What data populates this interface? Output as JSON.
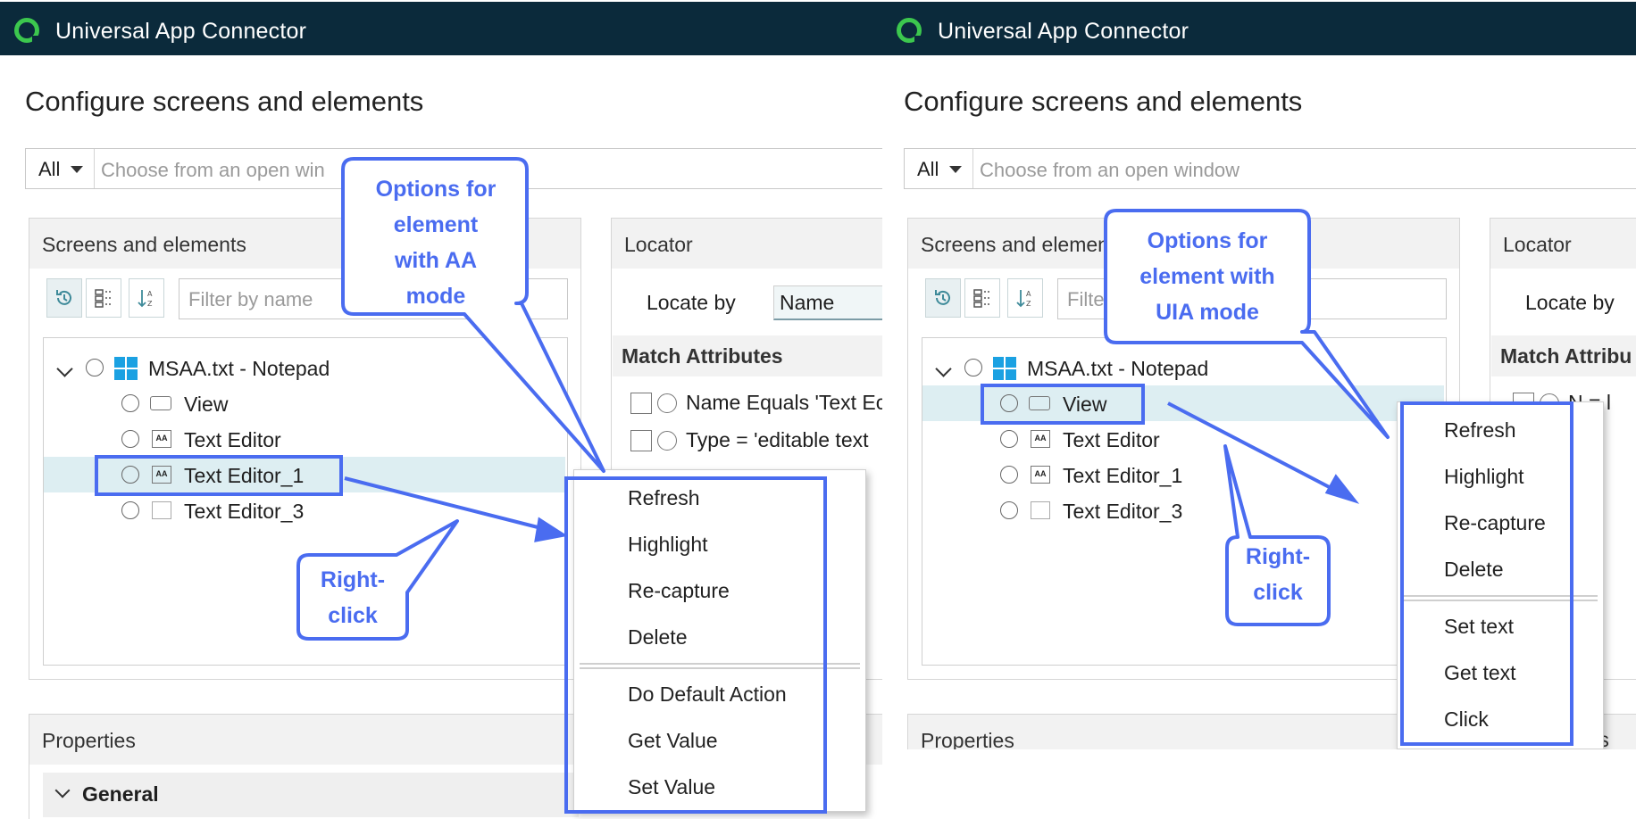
{
  "app": {
    "title": "Universal App Connector"
  },
  "page": {
    "title": "Configure screens and elements"
  },
  "search": {
    "scope": "All",
    "placeholder": "Choose from an open window",
    "placeholder_cut": "Choose from an open win"
  },
  "screens_panel": {
    "header": "Screens and elements",
    "header_cut": "Screens and elemen",
    "filter_placeholder": "Filter by name",
    "filter_placeholder_cut": "Filter",
    "tree": {
      "root": "MSAA.txt - Notepad",
      "children": [
        "View",
        "Text Editor",
        "Text Editor_1",
        "Text Editor_3"
      ]
    }
  },
  "locator_panel": {
    "header": "Locator",
    "locate_by_label": "Locate by",
    "locate_by_value": "Name",
    "match_attributes": "Match Attributes",
    "match_attributes_cut": "Match Attribu",
    "attributes": [
      "Name Equals 'Text Ec",
      "Type = 'editable text"
    ],
    "attr_right_cut": [
      "N = l",
      "="
    ]
  },
  "properties_panel": {
    "header": "Properties",
    "general": "General",
    "right_cut_header": "ts"
  },
  "left_menu": {
    "items_top": [
      "Refresh",
      "Highlight",
      "Re-capture",
      "Delete"
    ],
    "items_bottom": [
      "Do Default Action",
      "Get Value",
      "Set Value"
    ]
  },
  "right_menu": {
    "items_top": [
      "Refresh",
      "Highlight",
      "Re-capture",
      "Delete"
    ],
    "items_bottom": [
      "Set text",
      "Get text",
      "Click"
    ]
  },
  "annotations": {
    "left_callout": [
      "Options for",
      "element",
      "with AA",
      "mode"
    ],
    "right_callout": [
      "Options for",
      "element with",
      "UIA mode"
    ],
    "left_click": [
      "Right-",
      "click"
    ],
    "right_click": [
      "Right-",
      "click"
    ]
  },
  "colors": {
    "titlebar": "#0b2a3b",
    "accent": "#4a6cf0",
    "logo": "#3cc74e",
    "selection": "#ddeef2"
  }
}
